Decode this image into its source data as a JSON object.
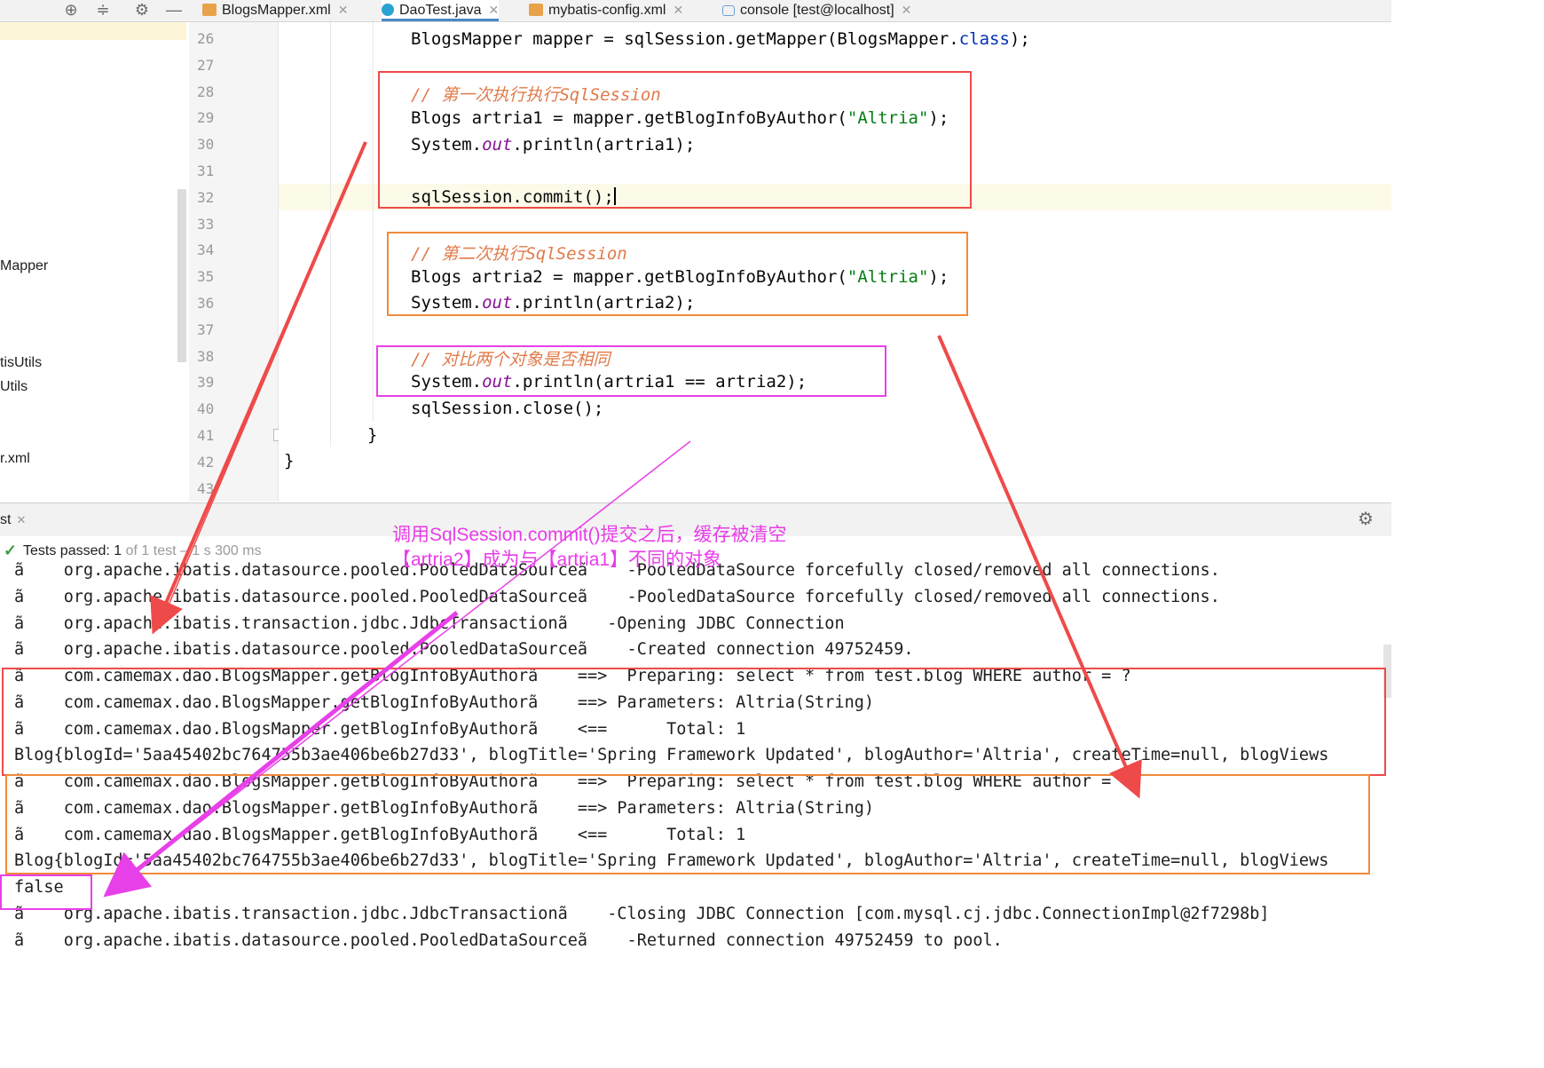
{
  "toolbar": {
    "icons": [
      "crosshair-icon",
      "collapse-all-icon",
      "gear-icon",
      "minimize-icon"
    ]
  },
  "tabs": [
    {
      "label": "BlogsMapper.xml",
      "icon": "xml-file-icon"
    },
    {
      "label": "DaoTest.java",
      "icon": "java-class-icon"
    },
    {
      "label": "mybatis-config.xml",
      "icon": "xml-file-icon"
    },
    {
      "label": "console [test@localhost]",
      "icon": "database-console-icon"
    }
  ],
  "project": {
    "items": [
      "Mapper",
      "tisUtils",
      "Utils",
      "r.xml"
    ]
  },
  "editor": {
    "line_numbers": [
      "26",
      "27",
      "28",
      "29",
      "30",
      "31",
      "32",
      "33",
      "34",
      "35",
      "36",
      "37",
      "38",
      "39",
      "40",
      "41",
      "42",
      "43"
    ],
    "lines": {
      "l26_a": "BlogsMapper mapper = sqlSession.getMapper(BlogsMapper.",
      "l26_kw": "class",
      "l26_b": ");",
      "l28_cmt": "// 第一次执行执行SqlSession",
      "l29_a": "Blogs artria1 = mapper.getBlogInfoByAuthor(",
      "l29_str": "\"Altria\"",
      "l29_b": ");",
      "l30_a": "System.",
      "l30_fld": "out",
      "l30_b": ".println(artria1);",
      "l32": "sqlSession.commit();",
      "l34_cmt": "// 第二次执行SqlSession",
      "l35_a": "Blogs artria2 = mapper.getBlogInfoByAuthor(",
      "l35_str": "\"Altria\"",
      "l35_b": ");",
      "l36_a": "System.",
      "l36_fld": "out",
      "l36_b": ".println(artria2);",
      "l38_cmt": "// 对比两个对象是否相同",
      "l39_a": "System.",
      "l39_fld": "out",
      "l39_b": ".println(artria1 == artria2);",
      "l40": "sqlSession.close();",
      "l41": "}",
      "l42": "}"
    }
  },
  "run": {
    "tab_label": "st",
    "status_passed": "Tests passed: 1",
    "status_rest": "of 1 test – 1 s 300 ms"
  },
  "console": {
    "lines": [
      "ã    org.apache.ibatis.datasource.pooled.PooledDataSourceã    -PooledDataSource forcefully closed/removed all connections.",
      "ã    org.apache.ibatis.datasource.pooled.PooledDataSourceã    -PooledDataSource forcefully closed/removed all connections.",
      "ã    org.apache.ibatis.transaction.jdbc.JdbcTransactionã    -Opening JDBC Connection",
      "ã    org.apache.ibatis.datasource.pooled.PooledDataSourceã    -Created connection 49752459.",
      "ã    com.camemax.dao.BlogsMapper.getBlogInfoByAuthorã    ==>  Preparing: select * from test.blog WHERE author = ?",
      "ã    com.camemax.dao.BlogsMapper.getBlogInfoByAuthorã    ==> Parameters: Altria(String)",
      "ã    com.camemax.dao.BlogsMapper.getBlogInfoByAuthorã    <==      Total: 1",
      "Blog{blogId='5aa45402bc764755b3ae406be6b27d33', blogTitle='Spring Framework Updated', blogAuthor='Altria', createTime=null, blogViews",
      "ã    com.camemax.dao.BlogsMapper.getBlogInfoByAuthorã    ==>  Preparing: select * from test.blog WHERE author = ?",
      "ã    com.camemax.dao.BlogsMapper.getBlogInfoByAuthorã    ==> Parameters: Altria(String)",
      "ã    com.camemax.dao.BlogsMapper.getBlogInfoByAuthorã    <==      Total: 1",
      "Blog{blogId='5aa45402bc764755b3ae406be6b27d33', blogTitle='Spring Framework Updated', blogAuthor='Altria', createTime=null, blogViews",
      "false",
      "ã    org.apache.ibatis.transaction.jdbc.JdbcTransactionã    -Closing JDBC Connection [com.mysql.cj.jdbc.ConnectionImpl@2f7298b]",
      "ã    org.apache.ibatis.datasource.pooled.PooledDataSourceã    -Returned connection 49752459 to pool."
    ]
  },
  "annotation": {
    "line1": "调用SqlSession.commit()提交之后，缓存被清空",
    "line2": "【artria2】成为与【artria1】不同的对象"
  },
  "colors": {
    "first_session_box": "#ef4a4a",
    "second_session_box": "#f08a3a",
    "compare_box": "#e840e8",
    "comment": "#e07a4a",
    "keyword": "#0033b3",
    "string": "#067d17",
    "static_field": "#871094"
  }
}
